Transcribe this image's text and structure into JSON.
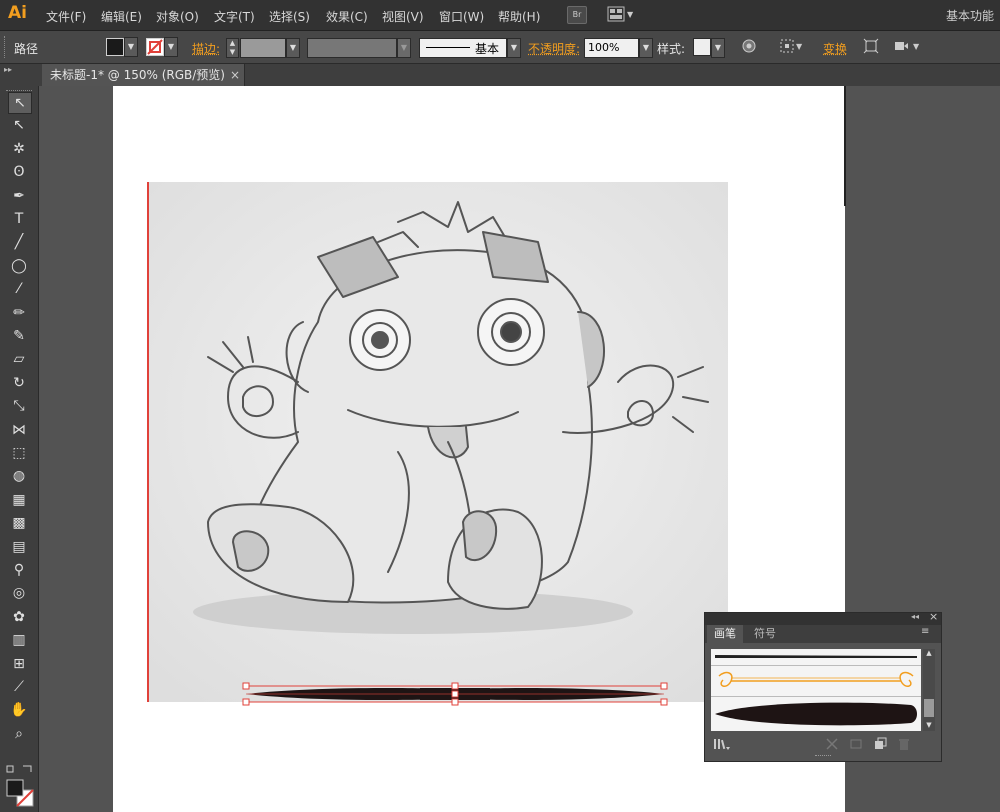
{
  "app": {
    "logo": "Ai",
    "workspace": "基本功能"
  },
  "menu": [
    "文件(F)",
    "编辑(E)",
    "对象(O)",
    "文字(T)",
    "选择(S)",
    "效果(C)",
    "视图(V)",
    "窗口(W)",
    "帮助(H)"
  ],
  "menu_icons": {
    "bridge": "Br"
  },
  "control": {
    "selection_type": "路径",
    "stroke_label": "描边:",
    "brush_name": "基本",
    "opacity_label": "不透明度:",
    "opacity_value": "100%",
    "style_label": "样式:",
    "transform_label": "变换"
  },
  "document": {
    "tab_title": "未标题-1* @ 150% (RGB/预览)",
    "tab_close": "×"
  },
  "brushes_panel": {
    "tabs": [
      "画笔",
      "符号"
    ],
    "header_collapse": "◂◂",
    "header_close": "×",
    "menu_icon": "≡"
  },
  "colors": {
    "accent": "#f29e1f",
    "selection": "#e0413a",
    "brush_fill": "#1e1414"
  },
  "tools": [
    "selection-tool",
    "direct-selection-tool",
    "magic-wand-tool",
    "lasso-tool",
    "pen-tool",
    "type-tool",
    "line-segment-tool",
    "ellipse-tool",
    "paintbrush-tool",
    "pencil-tool",
    "blob-brush-tool",
    "eraser-tool",
    "rotate-tool",
    "scale-tool",
    "width-tool",
    "free-transform-tool",
    "shape-builder-tool",
    "perspective-grid-tool",
    "mesh-tool",
    "gradient-tool",
    "eyedropper-tool",
    "blend-tool",
    "symbol-sprayer-tool",
    "column-graph-tool",
    "artboard-tool",
    "slice-tool",
    "hand-tool",
    "zoom-tool"
  ]
}
